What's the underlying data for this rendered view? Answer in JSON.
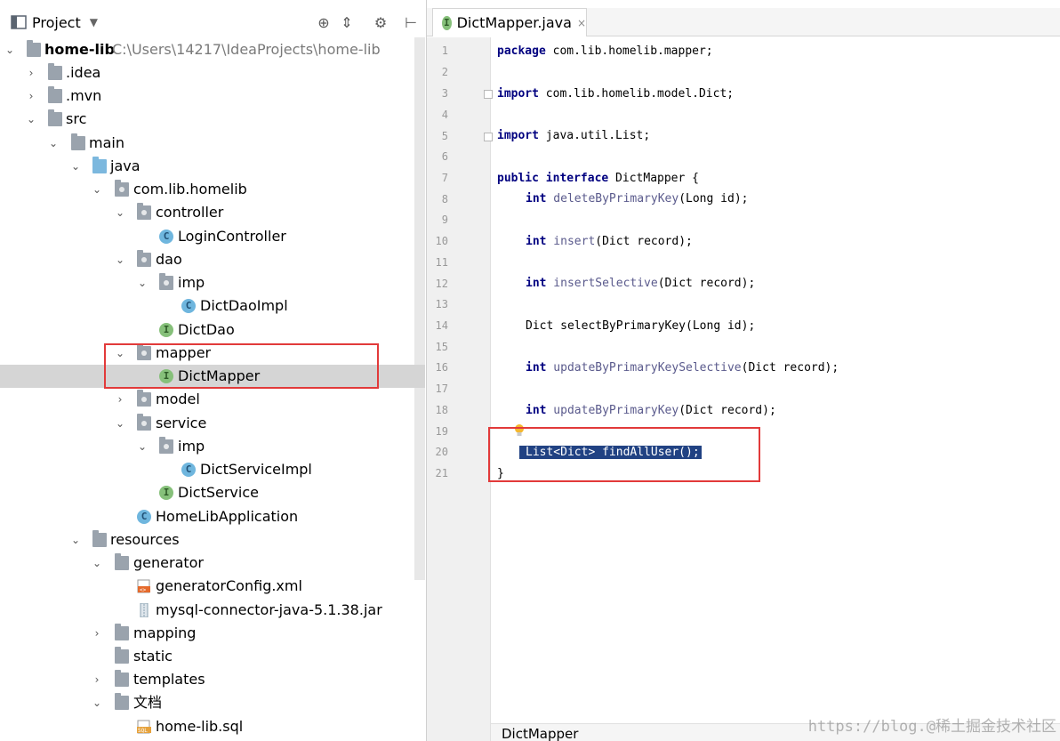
{
  "project_panel": {
    "title": "Project",
    "dropdown_icon": "chevron-down-icon",
    "toolbar_icons": [
      "crosshair-icon",
      "collapse-icon",
      "gear-icon",
      "pin-icon"
    ]
  },
  "tree": {
    "root": {
      "label": "home-lib",
      "path": "C:\\Users\\14217\\IdeaProjects\\home-lib"
    },
    "items": {
      "idea": ".idea",
      "mvn": ".mvn",
      "src": "src",
      "main": "main",
      "java": "java",
      "pkg": "com.lib.homelib",
      "controller": "controller",
      "login_controller": "LoginController",
      "dao": "dao",
      "dao_imp": "imp",
      "dict_dao_impl": "DictDaoImpl",
      "dict_dao": "DictDao",
      "mapper": "mapper",
      "dict_mapper": "DictMapper",
      "model": "model",
      "service": "service",
      "service_imp": "imp",
      "dict_service_impl": "DictServiceImpl",
      "dict_service": "DictService",
      "app": "HomeLibApplication",
      "resources": "resources",
      "generator": "generator",
      "generator_config": "generatorConfig.xml",
      "mysql_jar": "mysql-connector-java-5.1.38.jar",
      "mapping": "mapping",
      "static": "static",
      "templates": "templates",
      "docs": "文档",
      "sql_file": "home-lib.sql"
    },
    "badges": {
      "class": "C",
      "interface": "I"
    }
  },
  "editor": {
    "tab_label": "DictMapper.java",
    "tab_close": "×",
    "line_numbers": [
      "1",
      "2",
      "3",
      "4",
      "5",
      "6",
      "7",
      "8",
      "9",
      "10",
      "11",
      "12",
      "13",
      "14",
      "15",
      "16",
      "17",
      "18",
      "19",
      "20",
      "21"
    ],
    "code": {
      "l1_kw": "package",
      "l1_rest": " com.lib.homelib.mapper;",
      "l3_kw": "import",
      "l3_rest": " com.lib.homelib.model.Dict;",
      "l5_kw": "import",
      "l5_rest": " java.util.List;",
      "l7_kw": "public interface",
      "l7_rest": " DictMapper {",
      "l8_kw": "int",
      "l8_fn": " deleteByPrimaryKey",
      "l8_rest": "(Long id);",
      "l10_kw": "int",
      "l10_fn": " insert",
      "l10_rest": "(Dict record);",
      "l12_kw": "int",
      "l12_fn": " insertSelective",
      "l12_rest": "(Dict record);",
      "l14": "Dict selectByPrimaryKey(Long id);",
      "l16_kw": "int",
      "l16_fn": " updateByPrimaryKeySelective",
      "l16_rest": "(Dict record);",
      "l18_kw": "int",
      "l18_fn": " updateByPrimaryKey",
      "l18_rest": "(Dict record);",
      "l20": "List<Dict> findAllUser();",
      "l21": "}"
    },
    "breadcrumb": "DictMapper"
  },
  "watermark": "https://blog.@稀土掘金技术社区",
  "colors": {
    "selection": "#214283",
    "highlight_box": "#e23a3a",
    "selected_row": "#d5d5d5"
  }
}
